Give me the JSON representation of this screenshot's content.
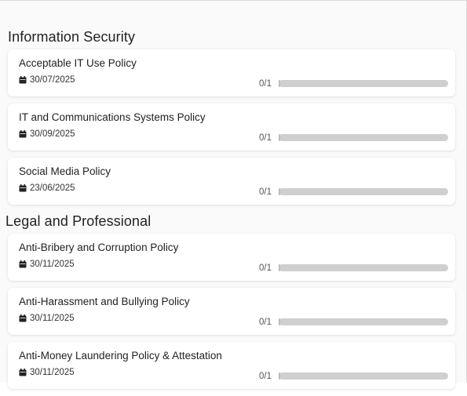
{
  "sections": [
    {
      "title": "Information Security",
      "items": [
        {
          "title": "Acceptable IT Use Policy",
          "date": "30/07/2025",
          "progress": "0/1",
          "fraction": 0
        },
        {
          "title": "IT and Communications Systems Policy",
          "date": "30/09/2025",
          "progress": "0/1",
          "fraction": 0
        },
        {
          "title": "Social Media Policy",
          "date": "23/06/2025",
          "progress": "0/1",
          "fraction": 0
        }
      ]
    },
    {
      "title": "Legal and Professional",
      "items": [
        {
          "title": "Anti-Bribery and Corruption Policy",
          "date": "30/11/2025",
          "progress": "0/1",
          "fraction": 0
        },
        {
          "title": "Anti-Harassment and Bullying Policy",
          "date": "30/11/2025",
          "progress": "0/1",
          "fraction": 0
        },
        {
          "title": "Anti-Money Laundering Policy & Attestation",
          "date": "30/11/2025",
          "progress": "0/1",
          "fraction": 0
        }
      ]
    }
  ],
  "icons": {
    "date": "calendar-icon"
  },
  "colors": {
    "track": "#cfcfcf",
    "fill": "#4a90d9"
  }
}
